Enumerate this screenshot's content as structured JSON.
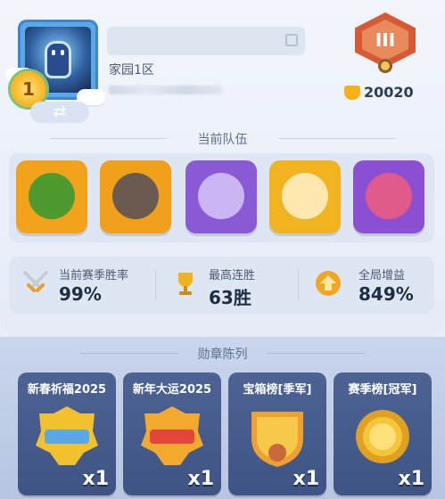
{
  "profile": {
    "level_badge": "1",
    "server": "家园1区",
    "rank_numeral": "III",
    "trophies": "20020"
  },
  "team": {
    "title": "当前队伍",
    "heroes": [
      {
        "color": "#f3a21c",
        "face": "#4f9a2f"
      },
      {
        "color": "#f0a01a",
        "face": "#6a5a50"
      },
      {
        "color": "#8a5ad6",
        "face": "#c9b6f2"
      },
      {
        "color": "#f2b321",
        "face": "#ffe8b0"
      },
      {
        "color": "#8a4fd3",
        "face": "#e05a8c"
      }
    ]
  },
  "stats": [
    {
      "label": "当前赛季胜率",
      "value": "99%",
      "icon": "crossed-swords-icon"
    },
    {
      "label": "最高连胜",
      "value": "63胜",
      "icon": "trophy-cup-icon"
    },
    {
      "label": "全局增益",
      "value": "849%",
      "icon": "boost-arrow-icon"
    }
  ],
  "medals": {
    "title": "勋章陈列",
    "items": [
      {
        "name": "新春祈福2025",
        "count": "x1",
        "icon": "gold-2025-medal-icon",
        "color": "#f2c12d"
      },
      {
        "name": "新年大运2025",
        "count": "x1",
        "icon": "red-2025-medal-icon",
        "color": "#f2a92d"
      },
      {
        "name": "宝箱榜[季军]",
        "count": "x1",
        "icon": "third-place-shield-icon",
        "color": "#f0a030"
      },
      {
        "name": "赛季榜[冠军]",
        "count": "x1",
        "icon": "champion-gold-medal-icon",
        "color": "#f5c53a"
      }
    ]
  }
}
